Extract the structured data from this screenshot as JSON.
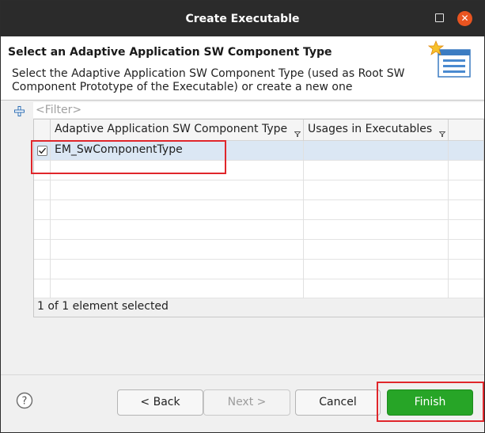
{
  "window": {
    "title": "Create Executable",
    "maximize_icon": "maximize-icon",
    "close_icon": "close-icon"
  },
  "header": {
    "title": "Select an Adaptive Application SW Component Type",
    "description": "Select the Adaptive Application SW Component Type (used as Root SW Component Prototype of the Executable) or create a new one",
    "icon": "wizard-banner-icon"
  },
  "filter": {
    "placeholder": "<Filter>",
    "value": ""
  },
  "add_icon": "add-plus-icon",
  "table": {
    "columns": [
      "Adaptive Application SW Component Type",
      "Usages in Executables"
    ],
    "rows": [
      {
        "checked": true,
        "type": "EM_SwComponentType",
        "usages": ""
      }
    ],
    "empty_rows": 7
  },
  "selection_status": "1 of 1 element selected",
  "buttons": {
    "help_icon": "help-icon",
    "back": "< Back",
    "next": "Next >",
    "cancel": "Cancel",
    "finish": "Finish"
  },
  "colors": {
    "titlebar": "#2b2b2b",
    "close_button": "#e95420",
    "finish_button": "#27a527",
    "selected_row": "#dbe7f4",
    "highlight": "#e0262b"
  }
}
